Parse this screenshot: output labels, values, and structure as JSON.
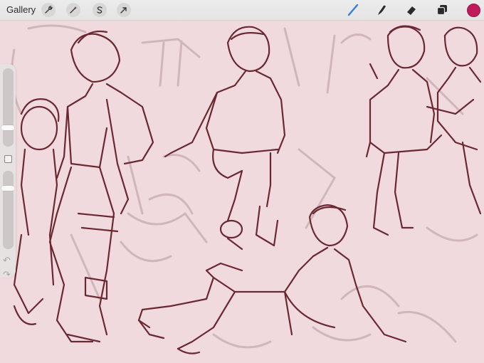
{
  "toolbar": {
    "gallery_label": "Gallery",
    "left_tools": [
      {
        "name": "actions",
        "icon": "wrench-icon"
      },
      {
        "name": "adjustments",
        "icon": "magic-wand-icon"
      },
      {
        "name": "selection",
        "icon": "selection-s-icon"
      },
      {
        "name": "transform",
        "icon": "arrow-cursor-icon"
      }
    ],
    "right_tools": [
      {
        "name": "brush",
        "icon": "brush-icon",
        "active": true
      },
      {
        "name": "smudge",
        "icon": "smudge-icon"
      },
      {
        "name": "eraser",
        "icon": "eraser-icon"
      },
      {
        "name": "layers",
        "icon": "layers-icon"
      }
    ],
    "current_color": "#c01b5d"
  },
  "sidebar": {
    "brush_size": 0.22,
    "opacity": 0.2,
    "modify_icon": "square-icon",
    "undo_icon": "undo-icon",
    "redo_icon": "redo-icon"
  },
  "canvas": {
    "background_color": "#f0dadd",
    "sketch_color": "#6e2a33",
    "underdrawing_color": "#c6a6aa"
  }
}
